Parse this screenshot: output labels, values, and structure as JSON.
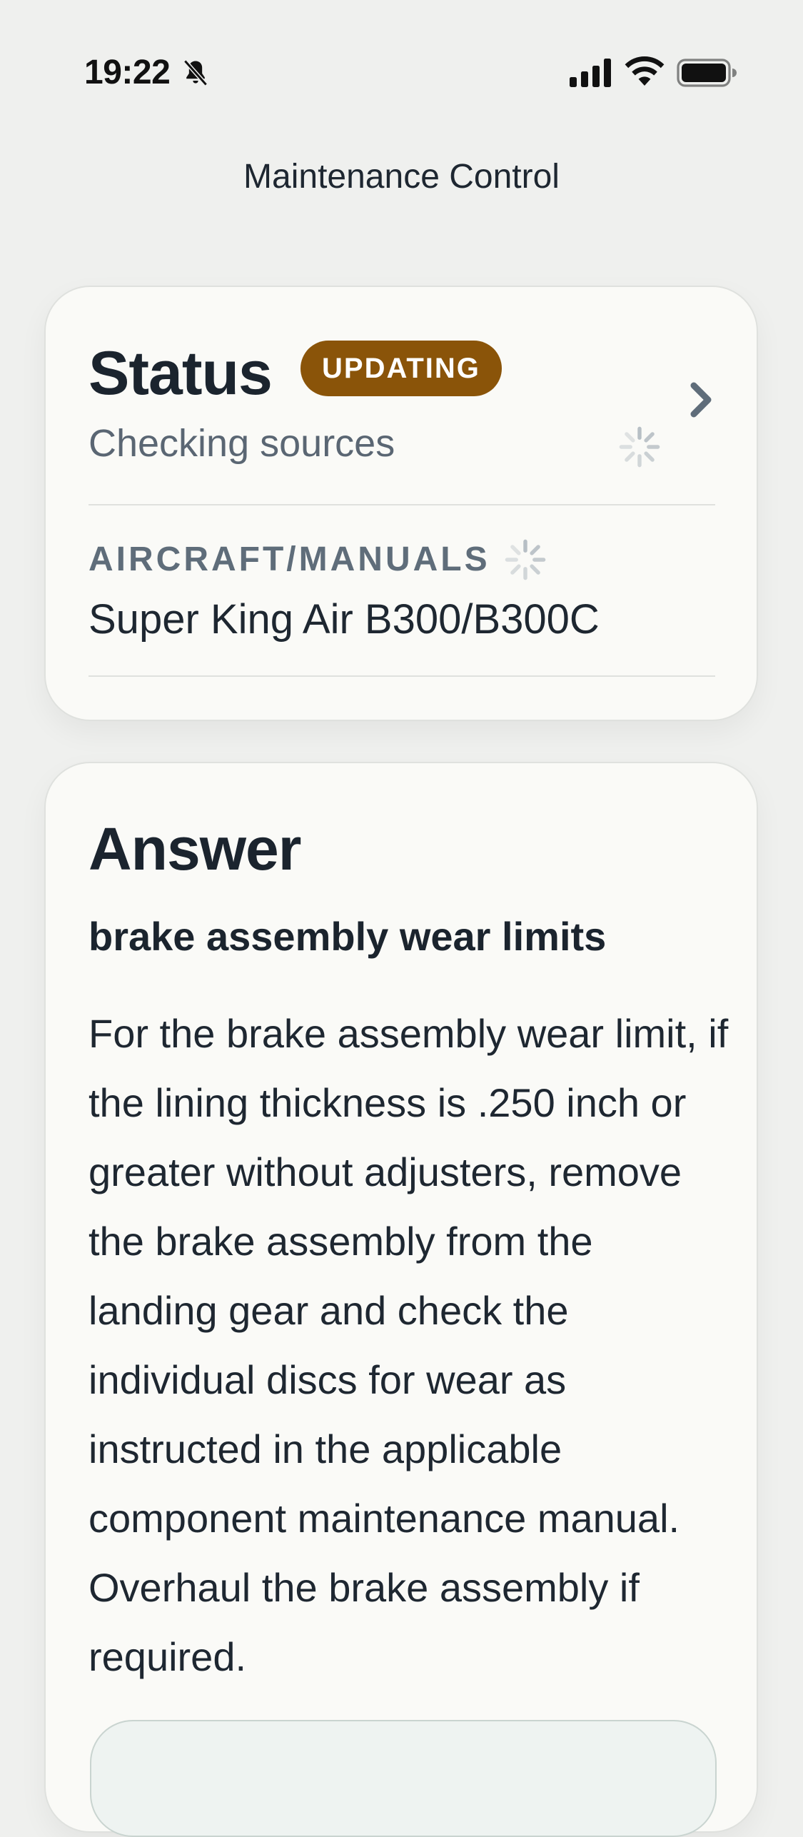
{
  "status_bar": {
    "time": "19:22",
    "icons": [
      "bell-slash-icon",
      "cellular-signal-icon",
      "wifi-icon",
      "battery-icon"
    ]
  },
  "nav": {
    "title": "Maintenance Control"
  },
  "status_card": {
    "title": "Status",
    "badge": "UPDATING",
    "subtitle": "Checking sources",
    "section_label": "AIRCRAFT/MANUALS",
    "aircraft": "Super King Air B300/B300C"
  },
  "answer_card": {
    "title": "Answer",
    "query": "brake assembly wear limits",
    "body": "For the brake assembly wear limit, if the lining thickness is .250 inch or greater without adjusters, remove the brake assembly from the landing gear and check the individual discs for wear as instructed in the applicable component maintenance manual. Overhaul the brake assembly if required."
  },
  "colors": {
    "background": "#eff0ee",
    "card": "#fafaf7",
    "badge": "#8a5409",
    "text": "#1e2731",
    "muted": "#5a6673"
  }
}
